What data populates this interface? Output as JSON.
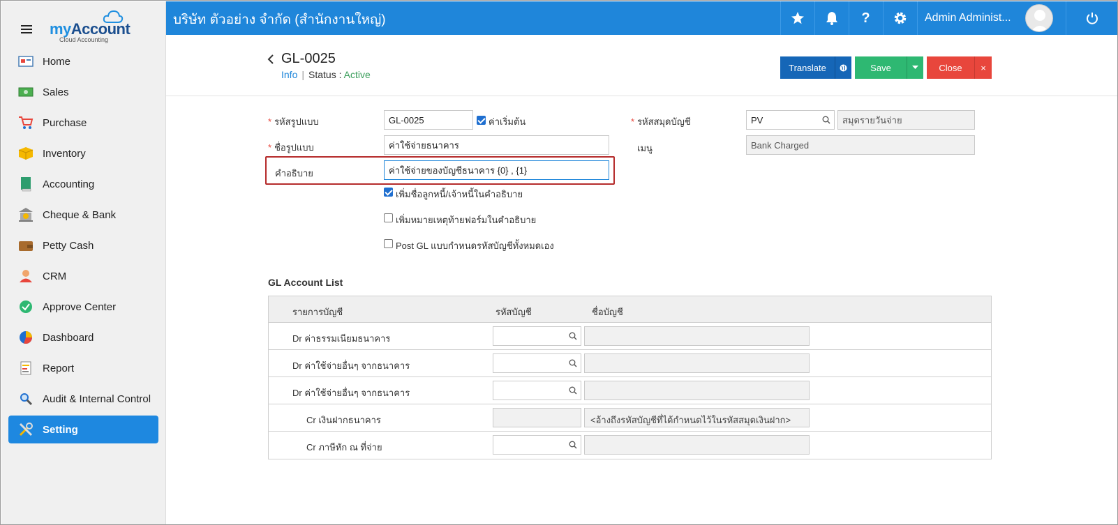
{
  "sidebar": {
    "logo": {
      "my": "my",
      "account": "Account",
      "sub": "Cloud Accounting"
    },
    "items": [
      {
        "label": "Home",
        "icon": "home-icon"
      },
      {
        "label": "Sales",
        "icon": "sales-icon"
      },
      {
        "label": "Purchase",
        "icon": "cart-icon"
      },
      {
        "label": "Inventory",
        "icon": "box-icon"
      },
      {
        "label": "Accounting",
        "icon": "book-icon"
      },
      {
        "label": "Cheque & Bank",
        "icon": "bank-icon"
      },
      {
        "label": "Petty Cash",
        "icon": "wallet-icon"
      },
      {
        "label": "CRM",
        "icon": "crm-icon"
      },
      {
        "label": "Approve Center",
        "icon": "check-circle-icon"
      },
      {
        "label": "Dashboard",
        "icon": "pie-chart-icon"
      },
      {
        "label": "Report",
        "icon": "report-icon"
      },
      {
        "label": "Audit & Internal Control",
        "icon": "magnifier-icon"
      },
      {
        "label": "Setting",
        "icon": "tools-icon",
        "active": true
      }
    ]
  },
  "topbar": {
    "company": "บริษัท ตัวอย่าง จำกัด (สำนักงานใหญ่)",
    "user": "Admin Administ..."
  },
  "header": {
    "title": "GL-0025",
    "info": "Info",
    "status_label": "Status",
    "status_colon": ":",
    "status_value": "Active",
    "translate": "Translate",
    "save": "Save",
    "close": "Close",
    "close_x": "×"
  },
  "form": {
    "code_label": "รหัสรูปแบบ",
    "code_value": "GL-0025",
    "default_label": "ค่าเริ่มต้น",
    "name_label": "ชื่อรูปแบบ",
    "name_value": "ค่าใช้จ่ายธนาคาร",
    "desc_label": "คำอธิบาย",
    "desc_value": "ค่าใช้จ่ายของบัญชีธนาคาร {0} , {1}",
    "journal_label": "รหัสสมุดบัญชี",
    "journal_code": "PV",
    "journal_name": "สมุดรายวันจ่าย",
    "menu_label": "เมนู",
    "menu_value": "Bank Charged",
    "opt1": "เพิ่มชื่อลูกหนี้/เจ้าหนี้ในคำอธิบาย",
    "opt2": "เพิ่มหมายเหตุท้ายฟอร์มในคำอธิบาย",
    "opt3": "Post GL แบบกำหนดรหัสบัญชีทั้งหมดเอง"
  },
  "gl": {
    "title": "GL Account List",
    "col_item": "รายการบัญชี",
    "col_code": "รหัสบัญชี",
    "col_name": "ชื่อบัญชี",
    "rows": [
      {
        "desc": "Dr ค่าธรรมเนียมธนาคาร",
        "name": ""
      },
      {
        "desc": "Dr ค่าใช้จ่ายอื่นๆ จากธนาคาร",
        "name": ""
      },
      {
        "desc": "Dr ค่าใช้จ่ายอื่นๆ จากธนาคาร",
        "name": ""
      },
      {
        "desc": "Cr เงินฝากธนาคาร",
        "name": "<อ้างถึงรหัสบัญชีที่ได้กำหนดไว้ในรหัสสมุดเงินฝาก>"
      },
      {
        "desc": "Cr ภาษีหัก ณ ที่จ่าย",
        "name": ""
      }
    ]
  }
}
